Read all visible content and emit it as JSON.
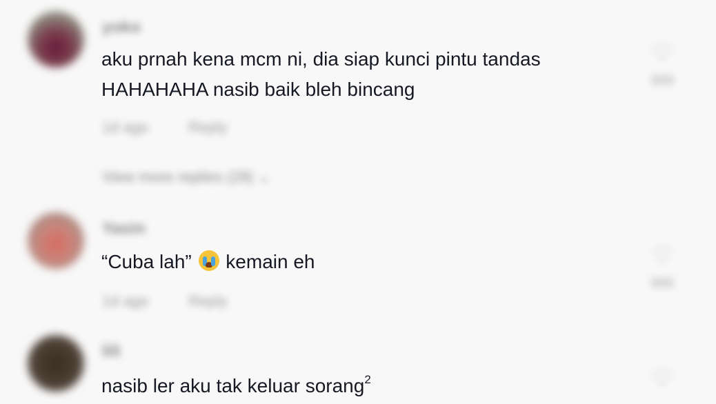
{
  "comments": [
    {
      "username": "yoko",
      "line1": "aku prnah kena mcm ni, dia siap kunci pintu tandas",
      "line2": "HAHAHAHA nasib baik bleh bincang",
      "time": "1d ago",
      "reply": "Reply",
      "likes": "999",
      "view_more": "View more replies (28)"
    },
    {
      "username": "Yasin",
      "text_before": "“Cuba lah”",
      "emoji": "loudly-crying-face",
      "text_after": "kemain eh",
      "time": "1d ago",
      "reply": "Reply",
      "likes": "999"
    },
    {
      "username": "lili",
      "text": "nasib ler aku tak keluar sorang",
      "superscript": "2",
      "likes": ""
    }
  ],
  "colors": {
    "background": "#f8f8f8",
    "text": "#161823",
    "muted": "#9a9a9a"
  }
}
